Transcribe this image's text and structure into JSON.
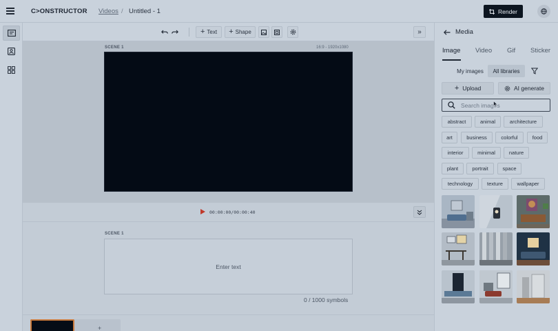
{
  "app": {
    "logo": "C>ONSTRUCTOR",
    "breadcrumb_link": "Videos",
    "breadcrumb_sep": "/",
    "project_title": "Untitled - 1",
    "render_label": "Render"
  },
  "toolbar": {
    "text_label": "Text",
    "shape_label": "Shape"
  },
  "canvas": {
    "scene_label": "SCENE 1",
    "ratio_label": "16:9 - 1920x1080"
  },
  "player": {
    "timecode": "00:00:00/00:00:40"
  },
  "script": {
    "scene_label": "SCENE 1",
    "placeholder": "Enter text",
    "symbol_count": "0 / 1000 symbols"
  },
  "timeline": {
    "add_label": "+"
  },
  "panel": {
    "title": "Media",
    "tabs": [
      "Image",
      "Video",
      "Gif",
      "Sticker"
    ],
    "active_tab": "Image",
    "library_options": [
      "My images",
      "All libraries"
    ],
    "selected_library": "All libraries",
    "upload_label": "Upload",
    "ai_label": "AI generate",
    "search_placeholder": "Search images",
    "tags": [
      "abstract",
      "animal",
      "architecture",
      "art",
      "business",
      "colorful",
      "food",
      "interior",
      "minimal",
      "nature",
      "plant",
      "portrait",
      "space",
      "technology",
      "texture",
      "wallpaper"
    ]
  },
  "colors": {
    "render_bg": "#0c1520",
    "accent_play": "#c0392b",
    "timeline_accent": "#c97a3d"
  }
}
